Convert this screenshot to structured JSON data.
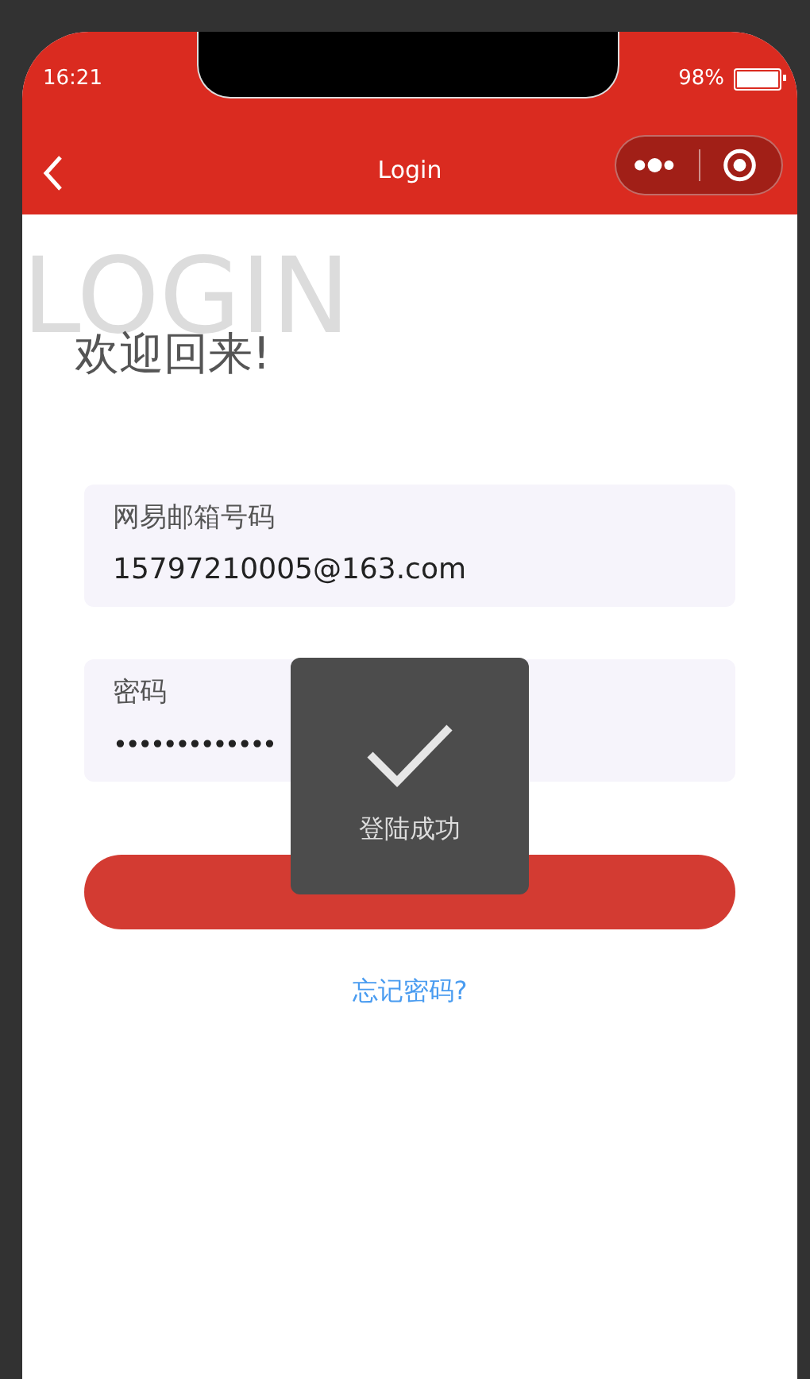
{
  "status_bar": {
    "time": "16:21",
    "battery": "98%"
  },
  "nav_bar": {
    "title": "Login"
  },
  "watermark": "LOGIN",
  "heading": "欢迎回来!",
  "fields": [
    {
      "label": "网易邮箱号码",
      "value": "15797210005@163.com"
    },
    {
      "label": "密码",
      "value": "•••••••••••••"
    }
  ],
  "forgot_link": "忘记密码?",
  "toast": {
    "message": "登陆成功"
  }
}
